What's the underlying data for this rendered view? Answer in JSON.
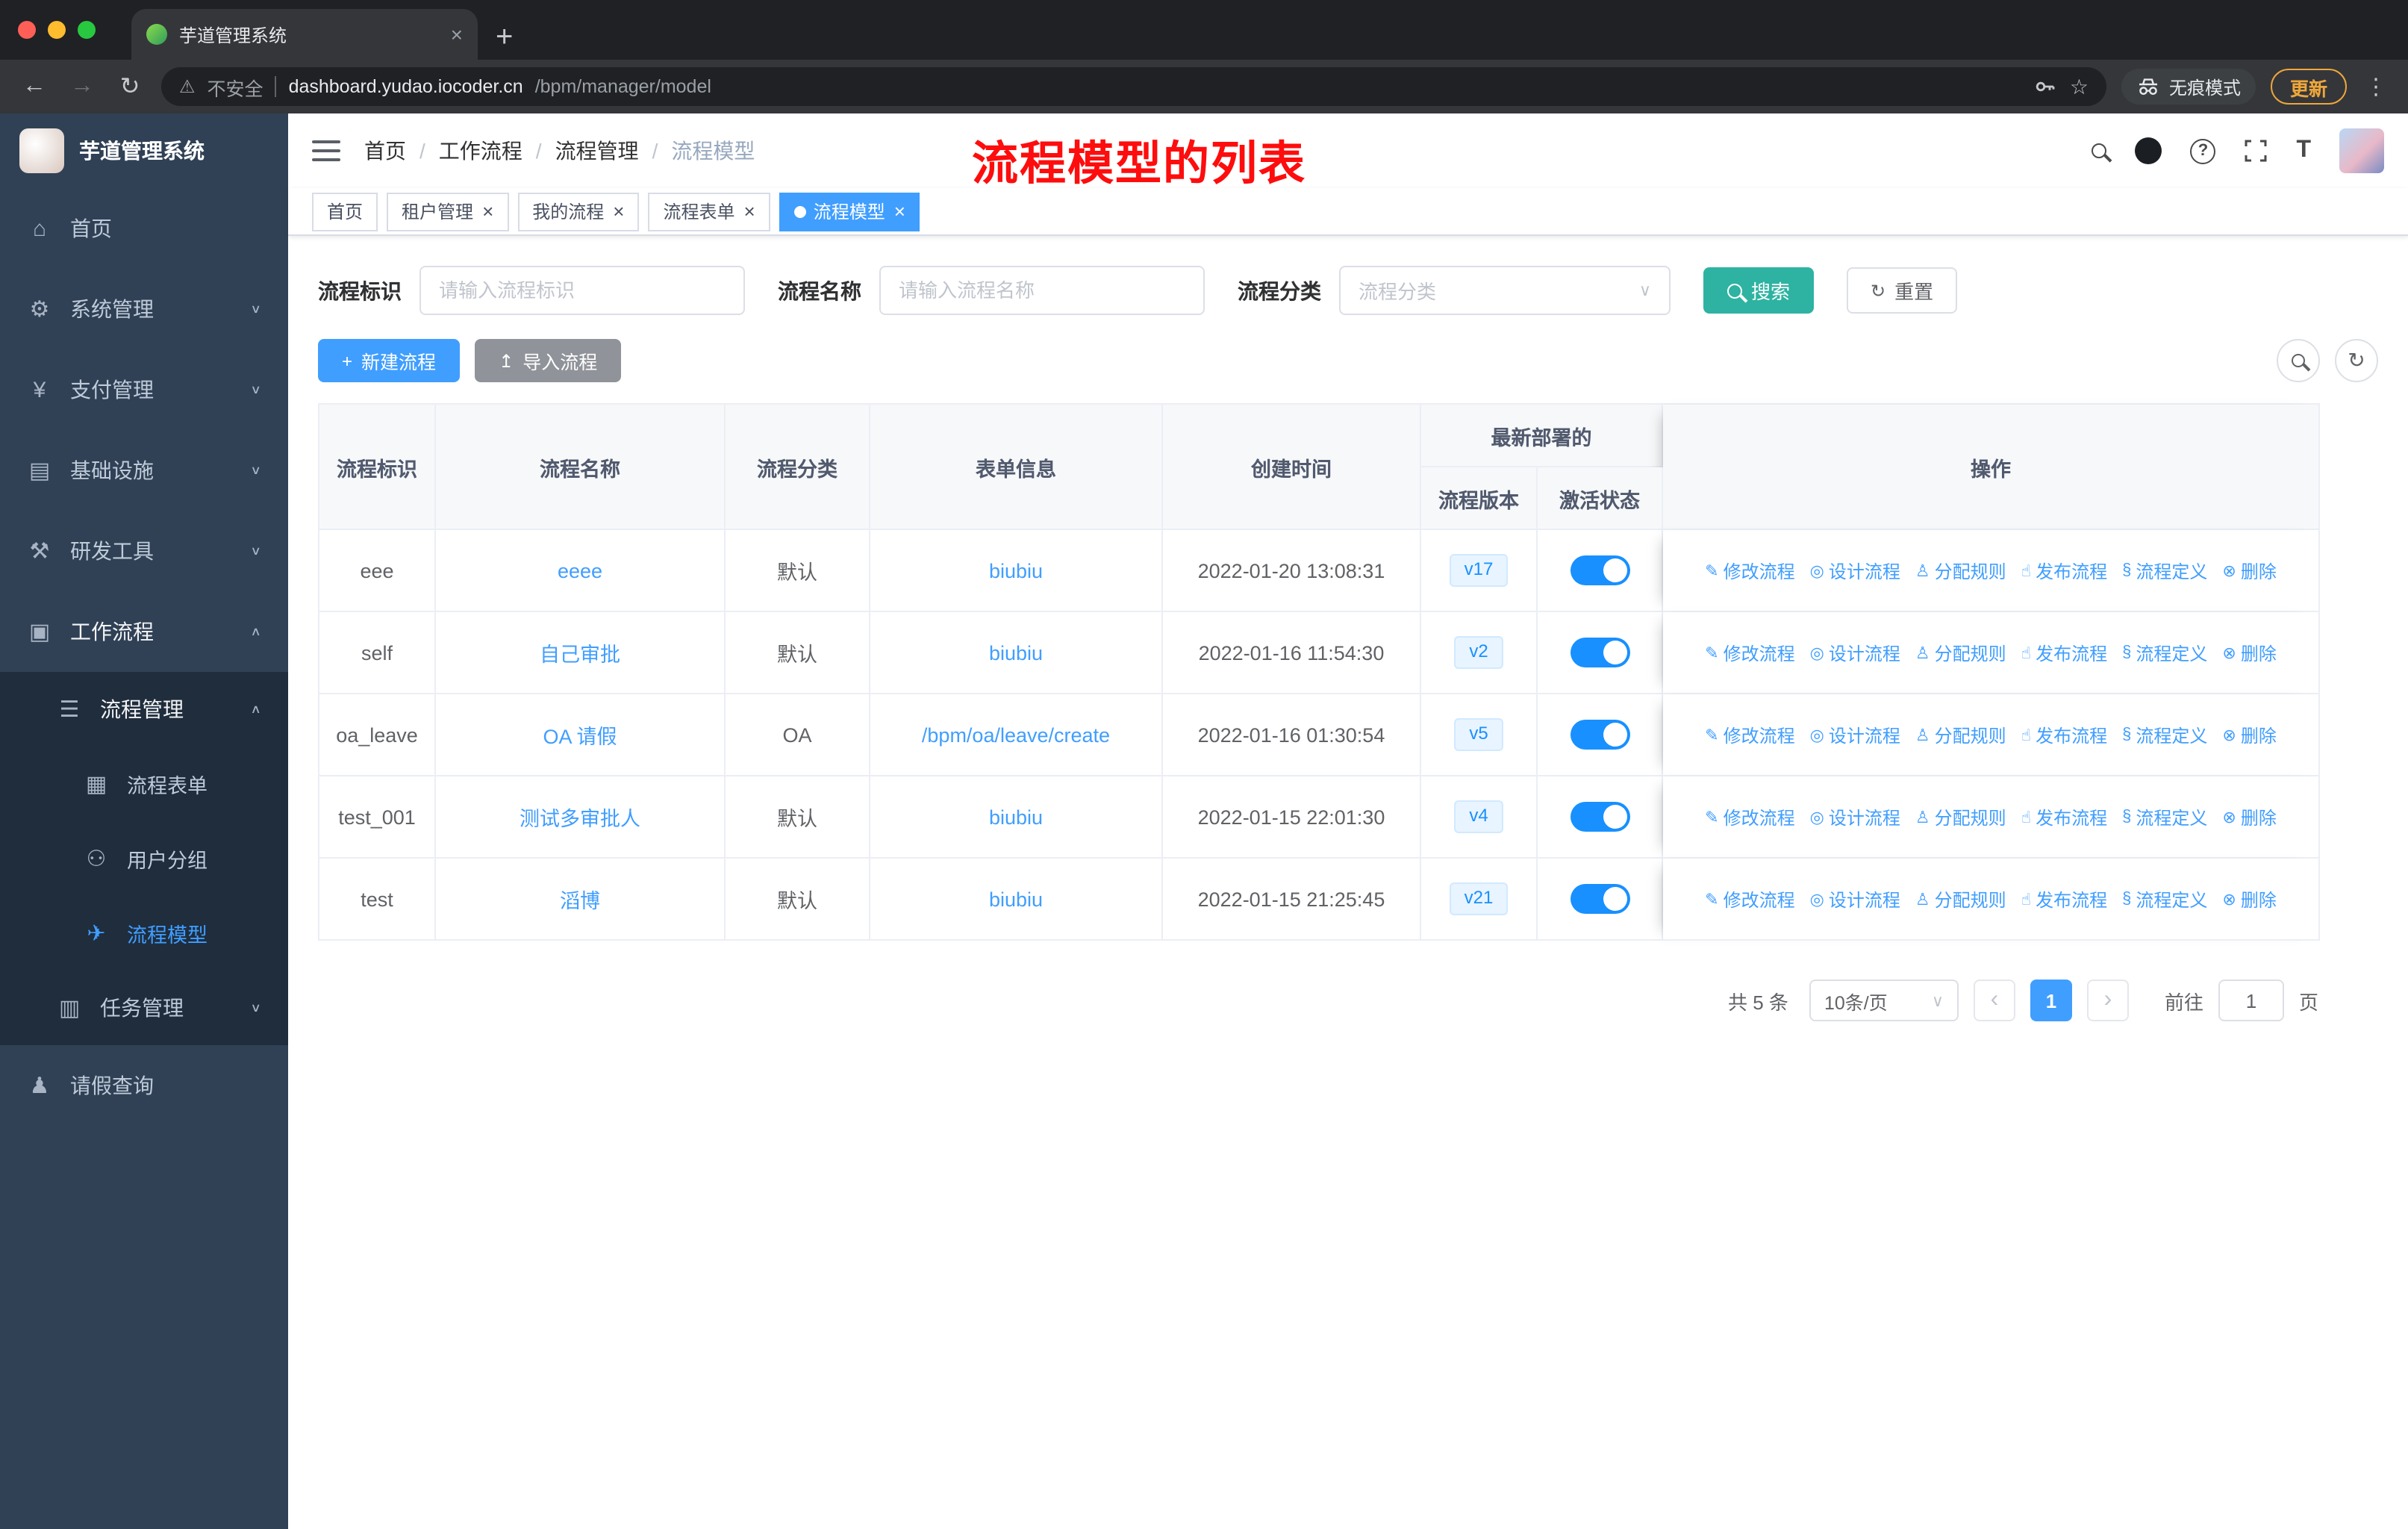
{
  "colors": {
    "accent": "#409eff",
    "switch_on": "#1890ff",
    "search_button": "#2eb3a2",
    "annotation_red": "#fd0d0d",
    "sidebar_bg": "#304156",
    "sidebar_submenu_bg": "#1f2d3d"
  },
  "browser": {
    "tab_title": "芋道管理系统",
    "close_tab": "×",
    "new_tab": "+",
    "back": "←",
    "forward": "→",
    "reload": "↻",
    "security_icon": "⚠",
    "security_label": "不安全",
    "url_host": "dashboard.yudao.iocoder.cn",
    "url_path": "/bpm/manager/model",
    "bookmark_star": "☆",
    "incognito_label": "无痕模式",
    "update_label": "更新",
    "menu_dots": "⋮"
  },
  "sidebar": {
    "logo_title": "芋道管理系统",
    "items": [
      {
        "icon": "⌂",
        "label": "首页",
        "cls": "lv1"
      },
      {
        "icon": "⚙",
        "label": "系统管理",
        "cls": "lv1",
        "chevron": "∨"
      },
      {
        "icon": "¥",
        "label": "支付管理",
        "cls": "lv1",
        "chevron": "∨"
      },
      {
        "icon": "▤",
        "label": "基础设施",
        "cls": "lv1",
        "chevron": "∨"
      },
      {
        "icon": "⚒",
        "label": "研发工具",
        "cls": "lv1",
        "chevron": "∨"
      },
      {
        "icon": "▣",
        "label": "工作流程",
        "cls": "lv1 open",
        "chevron": "∧"
      },
      {
        "icon": "☰",
        "label": "流程管理",
        "cls": "lv2 dark open",
        "chevron": "∧"
      },
      {
        "icon": "▦",
        "label": "流程表单",
        "cls": "lv3 dark"
      },
      {
        "icon": "⚇",
        "label": "用户分组",
        "cls": "lv3 dark"
      },
      {
        "icon": "✈",
        "label": "流程模型",
        "cls": "lv3 dark active"
      },
      {
        "icon": "▥",
        "label": "任务管理",
        "cls": "lv2 dark",
        "chevron": "∨"
      },
      {
        "icon": "♟",
        "label": "请假查询",
        "cls": "lv1"
      }
    ]
  },
  "navbar": {
    "breadcrumb": [
      {
        "label": "首页"
      },
      {
        "sep": "/",
        "label": "工作流程"
      },
      {
        "sep": "/",
        "label": "流程管理"
      },
      {
        "sep": "/",
        "label": "流程模型",
        "current": true
      }
    ],
    "annotation": "流程模型的列表",
    "help_glyph": "?",
    "font_icon": "T"
  },
  "tags": [
    {
      "label": "首页"
    },
    {
      "label": "租户管理",
      "closable": true,
      "close": "×"
    },
    {
      "label": "我的流程",
      "closable": true,
      "close": "×"
    },
    {
      "label": "流程表单",
      "closable": true,
      "close": "×"
    },
    {
      "label": "流程模型",
      "closable": true,
      "close": "×",
      "active": true
    }
  ],
  "filters": {
    "f1_label": "流程标识",
    "f1_placeholder": "请输入流程标识",
    "f2_label": "流程名称",
    "f2_placeholder": "请输入流程名称",
    "f3_label": "流程分类",
    "f3_placeholder": "流程分类",
    "select_arrow": "∨",
    "search_label": "搜索",
    "reset_icon": "↻",
    "reset_label": "重置"
  },
  "toolbar": {
    "plus": "+",
    "create_label": "新建流程",
    "upload": "↥",
    "import_label": "导入流程",
    "refresh_icon": "↻"
  },
  "table": {
    "columns": {
      "id": "流程标识",
      "name": "流程名称",
      "category": "流程分类",
      "form": "表单信息",
      "created": "创建时间",
      "group": "最新部署的",
      "version": "流程版本",
      "status": "激活状态",
      "ops": "操作"
    },
    "rows": [
      {
        "id": "eee",
        "name": "eeee",
        "category": "默认",
        "form": "biubiu",
        "created": "2022-01-20 13:08:31",
        "version": "v17",
        "active": true
      },
      {
        "id": "self",
        "name": "自己审批",
        "category": "默认",
        "form": "biubiu",
        "created": "2022-01-16 11:54:30",
        "version": "v2",
        "active": true
      },
      {
        "id": "oa_leave",
        "name": "OA 请假",
        "category": "OA",
        "form": "/bpm/oa/leave/create",
        "created": "2022-01-16 01:30:54",
        "version": "v5",
        "active": true
      },
      {
        "id": "test_001",
        "name": "测试多审批人",
        "category": "默认",
        "form": "biubiu",
        "created": "2022-01-15 22:01:30",
        "version": "v4",
        "active": true
      },
      {
        "id": "test",
        "name": "滔博",
        "category": "默认",
        "form": "biubiu",
        "created": "2022-01-15 21:25:45",
        "version": "v21",
        "active": true
      }
    ],
    "actions": [
      {
        "icon": "✎",
        "label": "修改流程"
      },
      {
        "icon": "◎",
        "label": "设计流程"
      },
      {
        "icon": "♙",
        "label": "分配规则"
      },
      {
        "icon": "☝",
        "label": "发布流程"
      },
      {
        "icon": "§",
        "label": "流程定义"
      },
      {
        "icon": "⊗",
        "label": "删除"
      }
    ]
  },
  "pagination": {
    "total": "共 5 条",
    "size": "10条/页",
    "arrow": "∨",
    "prev": "‹",
    "next": "›",
    "page": "1",
    "goto": "前往",
    "goto_value": "1",
    "unit": "页"
  }
}
